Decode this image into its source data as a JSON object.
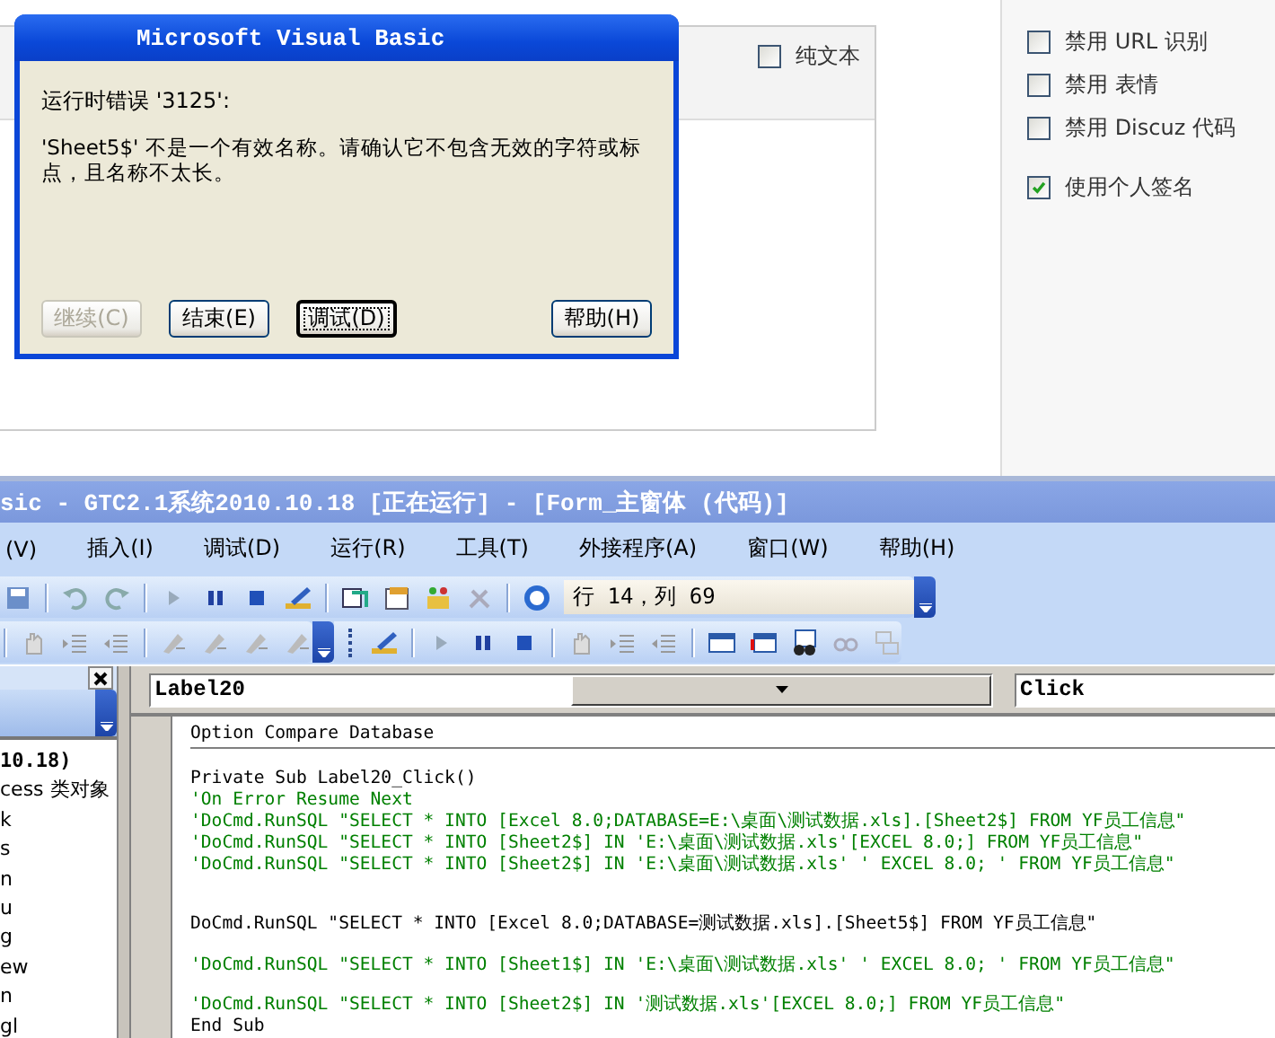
{
  "page": {
    "editor_options": [
      {
        "label": "纯文本",
        "checked": false
      }
    ],
    "post_options": [
      {
        "label": "禁用 URL 识别",
        "checked": false
      },
      {
        "label": "禁用 表情",
        "checked": false
      },
      {
        "label": "禁用 Discuz 代码",
        "checked": false
      },
      {
        "label": "使用个人签名",
        "checked": true
      }
    ]
  },
  "dialog": {
    "title": "Microsoft Visual Basic",
    "error": "运行时错误 '3125':",
    "message": "'Sheet5$' 不是一个有效名称。请确认它不包含无效的字符或标点，且名称不太长。",
    "buttons": [
      {
        "label": "继续(C)",
        "disabled": true,
        "focused": false
      },
      {
        "label": "结束(E)",
        "disabled": false,
        "focused": false
      },
      {
        "label": "调试(D)",
        "disabled": false,
        "focused": true
      },
      {
        "label": "帮助(H)",
        "disabled": false,
        "focused": false
      }
    ]
  },
  "vba": {
    "title": "sic - GTC2.1系统2010.10.18 [正在运行] - [Form_主窗体 (代码)]",
    "menu": [
      "(V)",
      "插入(I)",
      "调试(D)",
      "运行(R)",
      "工具(T)",
      "外接程序(A)",
      "窗口(W)",
      "帮助(H)"
    ],
    "position": "行 14，列 69",
    "project_items": [
      {
        "label": "10.18)",
        "kind": "project"
      },
      {
        "label": "cess 类对象",
        "kind": "folder"
      },
      {
        "label": "k",
        "kind": "module"
      },
      {
        "label": "s",
        "kind": "module"
      },
      {
        "label": "n",
        "kind": "module"
      },
      {
        "label": "u",
        "kind": "module"
      },
      {
        "label": "g",
        "kind": "module"
      },
      {
        "label": "ew",
        "kind": "module"
      },
      {
        "label": "n",
        "kind": "module"
      },
      {
        "label": "gl",
        "kind": "module"
      }
    ],
    "object_combo": "Label20",
    "procedure_combo": "Click",
    "code_lines": [
      {
        "kind": "declaration",
        "text": "Option Compare Database"
      },
      {
        "kind": "code",
        "text": "Private Sub Label20_Click()"
      },
      {
        "kind": "comment",
        "text": "'On Error Resume Next"
      },
      {
        "kind": "comment",
        "text": "'DoCmd.RunSQL \"SELECT * INTO [Excel 8.0;DATABASE=E:\\桌面\\测试数据.xls].[Sheet2$] FROM YF员工信息\""
      },
      {
        "kind": "comment",
        "text": "'DoCmd.RunSQL \"SELECT * INTO [Sheet2$] IN 'E:\\桌面\\测试数据.xls'[EXCEL 8.0;] FROM YF员工信息\""
      },
      {
        "kind": "comment",
        "text": "'DoCmd.RunSQL \"SELECT * INTO [Sheet2$] IN 'E:\\桌面\\测试数据.xls' ' EXCEL 8.0; ' FROM YF员工信息\""
      },
      {
        "kind": "blank"
      },
      {
        "kind": "blank"
      },
      {
        "kind": "code",
        "text": "DoCmd.RunSQL \"SELECT * INTO [Excel 8.0;DATABASE=测试数据.xls].[Sheet5$] FROM YF员工信息\""
      },
      {
        "kind": "blank"
      },
      {
        "kind": "comment",
        "text": "'DoCmd.RunSQL \"SELECT * INTO [Sheet1$] IN 'E:\\桌面\\测试数据.xls' ' EXCEL 8.0; ' FROM YF员工信息\""
      },
      {
        "kind": "blank"
      },
      {
        "kind": "comment",
        "text": "'DoCmd.RunSQL \"SELECT * INTO [Sheet2$] IN '测试数据.xls'[EXCEL 8.0;] FROM YF员工信息\""
      },
      {
        "kind": "code",
        "text": "End Sub"
      }
    ]
  }
}
